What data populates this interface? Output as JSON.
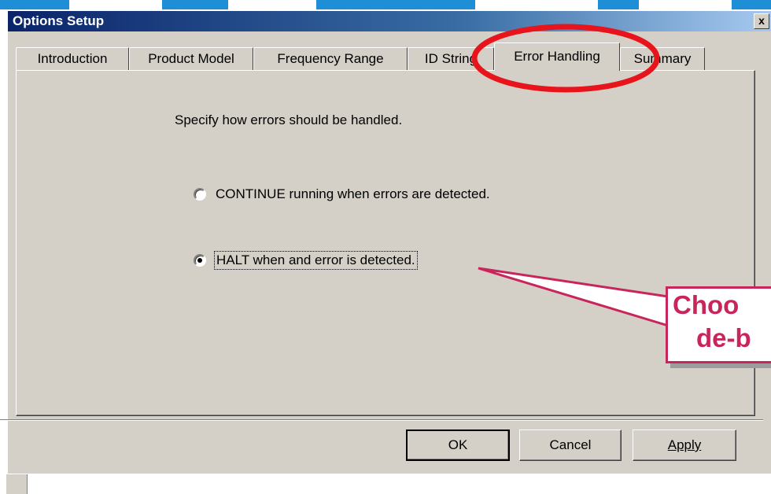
{
  "window": {
    "title": "Options Setup",
    "close_glyph": "x"
  },
  "tabs": [
    {
      "label": "Introduction",
      "active": false
    },
    {
      "label": "Product Model",
      "active": false
    },
    {
      "label": "Frequency Range",
      "active": false
    },
    {
      "label": "ID String",
      "active": false
    },
    {
      "label": "Error Handling",
      "active": true
    },
    {
      "label": "Summary",
      "active": false
    }
  ],
  "panel": {
    "prompt": "Specify how errors should be handled.",
    "options": [
      {
        "label": "CONTINUE running when errors are detected.",
        "selected": false
      },
      {
        "label": "HALT when and error is detected.",
        "selected": true
      }
    ]
  },
  "buttons": {
    "ok": "OK",
    "cancel": "Cancel",
    "apply": "Apply"
  },
  "callout": {
    "line1": "Choo",
    "line2": "de-b"
  },
  "colors": {
    "annotation_red": "#e8141c",
    "callout_magenta": "#c8255a",
    "slide_blue": "#1e8fd6"
  }
}
